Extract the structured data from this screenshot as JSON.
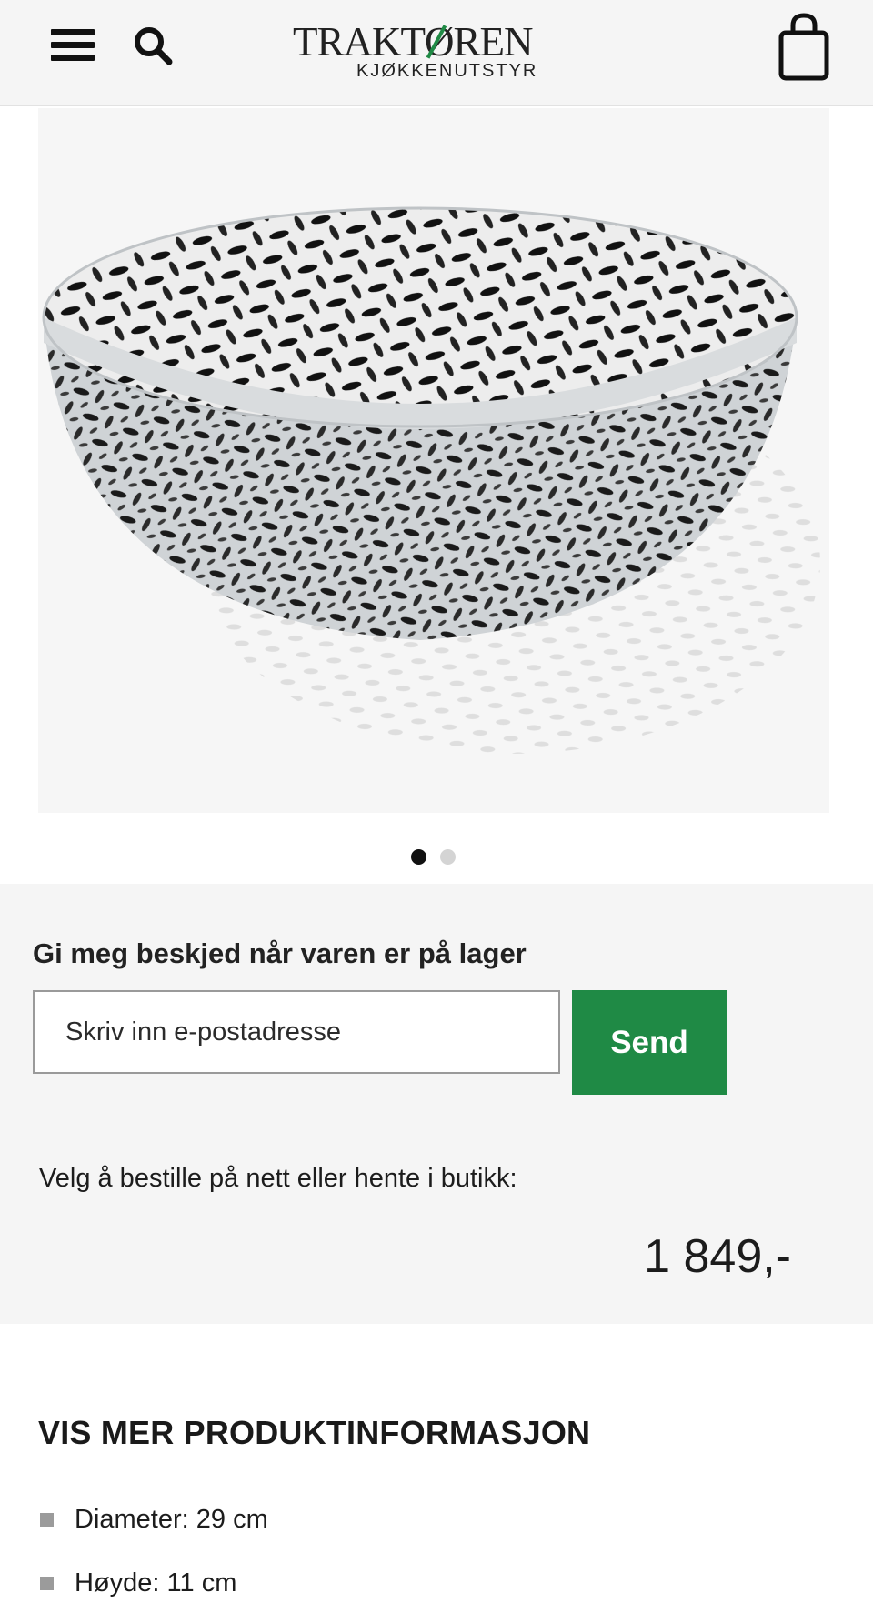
{
  "header": {
    "menu_icon": "hamburger-menu-icon",
    "search_icon": "search-icon",
    "logo": {
      "name": "TRAKTØREN",
      "tagline": "KJØKKENUTSTYR"
    },
    "cart_icon": "shopping-bag-icon",
    "background": "#f5f5f5"
  },
  "product_image": {
    "subject": "perforated stainless steel bowl",
    "carousel": {
      "total": 2,
      "active": 1
    }
  },
  "stock_notify": {
    "title": "Gi meg beskjed når varen er på lager",
    "email_placeholder": "Skriv inn e-postadresse",
    "email_value": "",
    "send_label": "Send",
    "button_color": "#1f8a45"
  },
  "purchase": {
    "order_text": "Velg å bestille på nett eller hente i butikk:",
    "price": "1 849,-"
  },
  "product_info": {
    "heading": "VIS MER PRODUKTINFORMASJON",
    "specs": [
      "Diameter: 29 cm",
      "Høyde: 11 cm"
    ]
  }
}
